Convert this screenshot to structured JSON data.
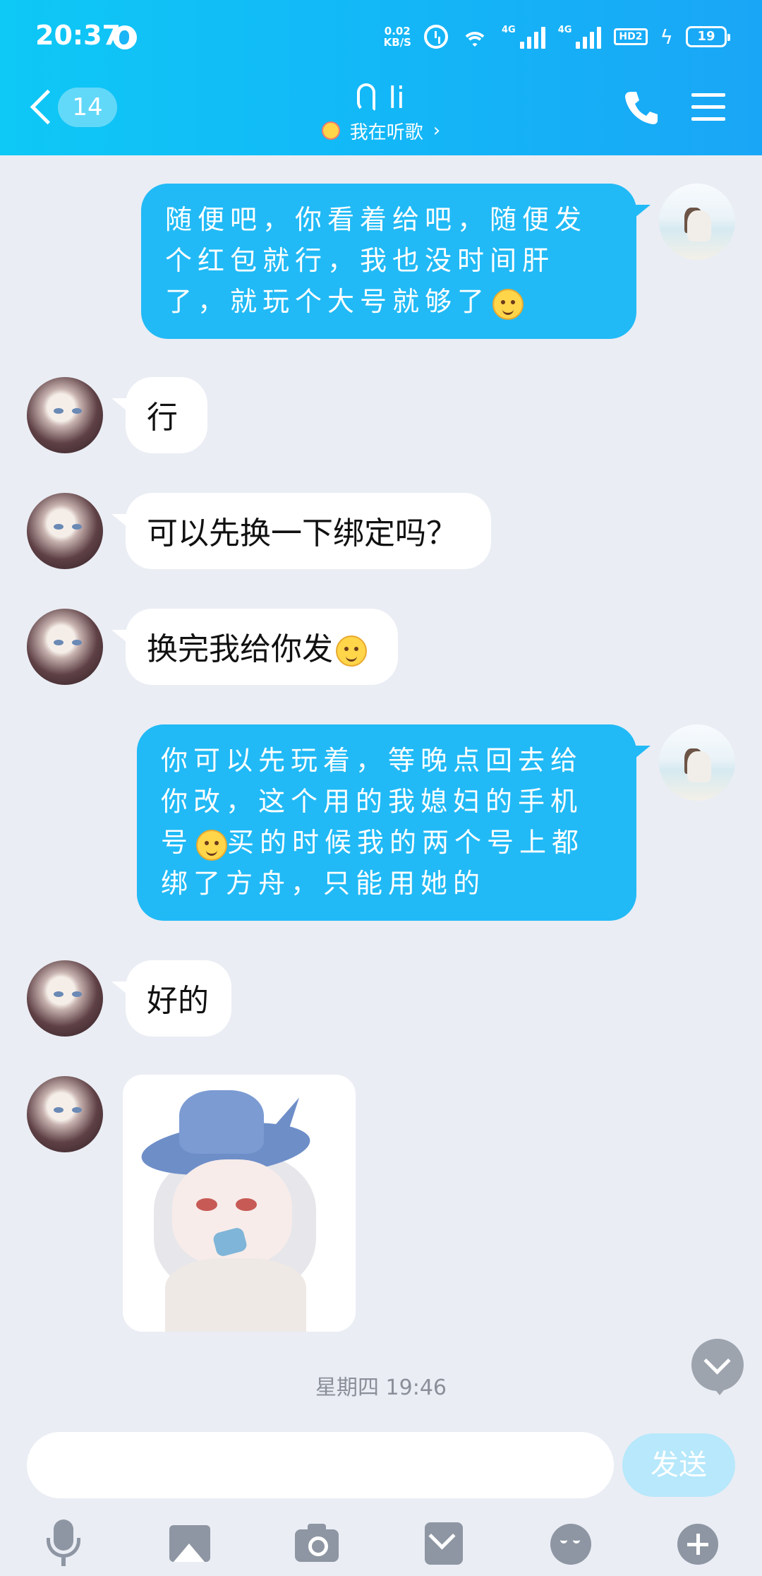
{
  "status_bar": {
    "time": "20:37",
    "net_speed_value": "0.02",
    "net_speed_unit": "KB/S",
    "signal1_label": "4G",
    "signal2_label": "4G",
    "hd_label": "HD2",
    "battery": "19"
  },
  "header": {
    "unread_count": "14",
    "contact_name": "li",
    "status_text": "我在听歌",
    "status_chevron": "›"
  },
  "messages": [
    {
      "from": "me",
      "text": "随便吧，你看着给吧，随便发个红包就行，我也没时间肝了，就玩个大号就够了"
    },
    {
      "from": "them",
      "text": "行"
    },
    {
      "from": "them",
      "text": "可以先换一下绑定吗？"
    },
    {
      "from": "them",
      "text": "换完我给你发"
    },
    {
      "from": "me",
      "text": "你可以先玩着，等晚点回去给你改，这个用的我媳妇的手机号"
    },
    {
      "from": "me",
      "text_cont": "买的时候我的两个号上都绑了方舟，只能用她的"
    },
    {
      "from": "them",
      "text": "好的"
    },
    {
      "from": "them",
      "type": "sticker"
    }
  ],
  "timestamp": "星期四 19:46",
  "composer": {
    "input_value": "",
    "send_label": "发送"
  },
  "toolbar": [
    "mic-icon",
    "image-icon",
    "camera-icon",
    "red-packet-icon",
    "emoji-icon",
    "plus-icon"
  ],
  "colors": {
    "header_gradient_start": "#0EC8F6",
    "header_gradient_end": "#1AA6F6",
    "my_bubble": "#21BAF6",
    "their_bubble": "#FFFFFF",
    "background": "#EAEDF4",
    "send_button_disabled": "#B7E8FB"
  }
}
